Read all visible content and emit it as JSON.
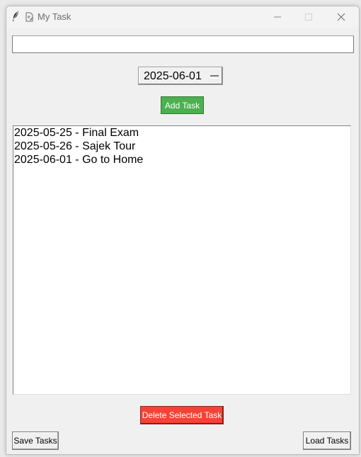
{
  "window": {
    "title": "My Task"
  },
  "task_entry": {
    "value": ""
  },
  "date_picker": {
    "value": "2025-06-01"
  },
  "buttons": {
    "add_task": "Add Task",
    "delete_selected": "Delete Selected Task",
    "save_tasks": "Save Tasks",
    "load_tasks": "Load Tasks"
  },
  "tasks": [
    "2025-05-25 - Final Exam",
    "2025-05-26 - Sajek Tour",
    "2025-06-01 - Go to Home"
  ],
  "colors": {
    "add_button": "#4caf50",
    "delete_button": "#f44336"
  },
  "icons": {
    "app": "feather-icon",
    "document": "document-edit-icon",
    "minimize": "minimize-icon",
    "maximize": "maximize-icon",
    "close": "close-icon"
  }
}
